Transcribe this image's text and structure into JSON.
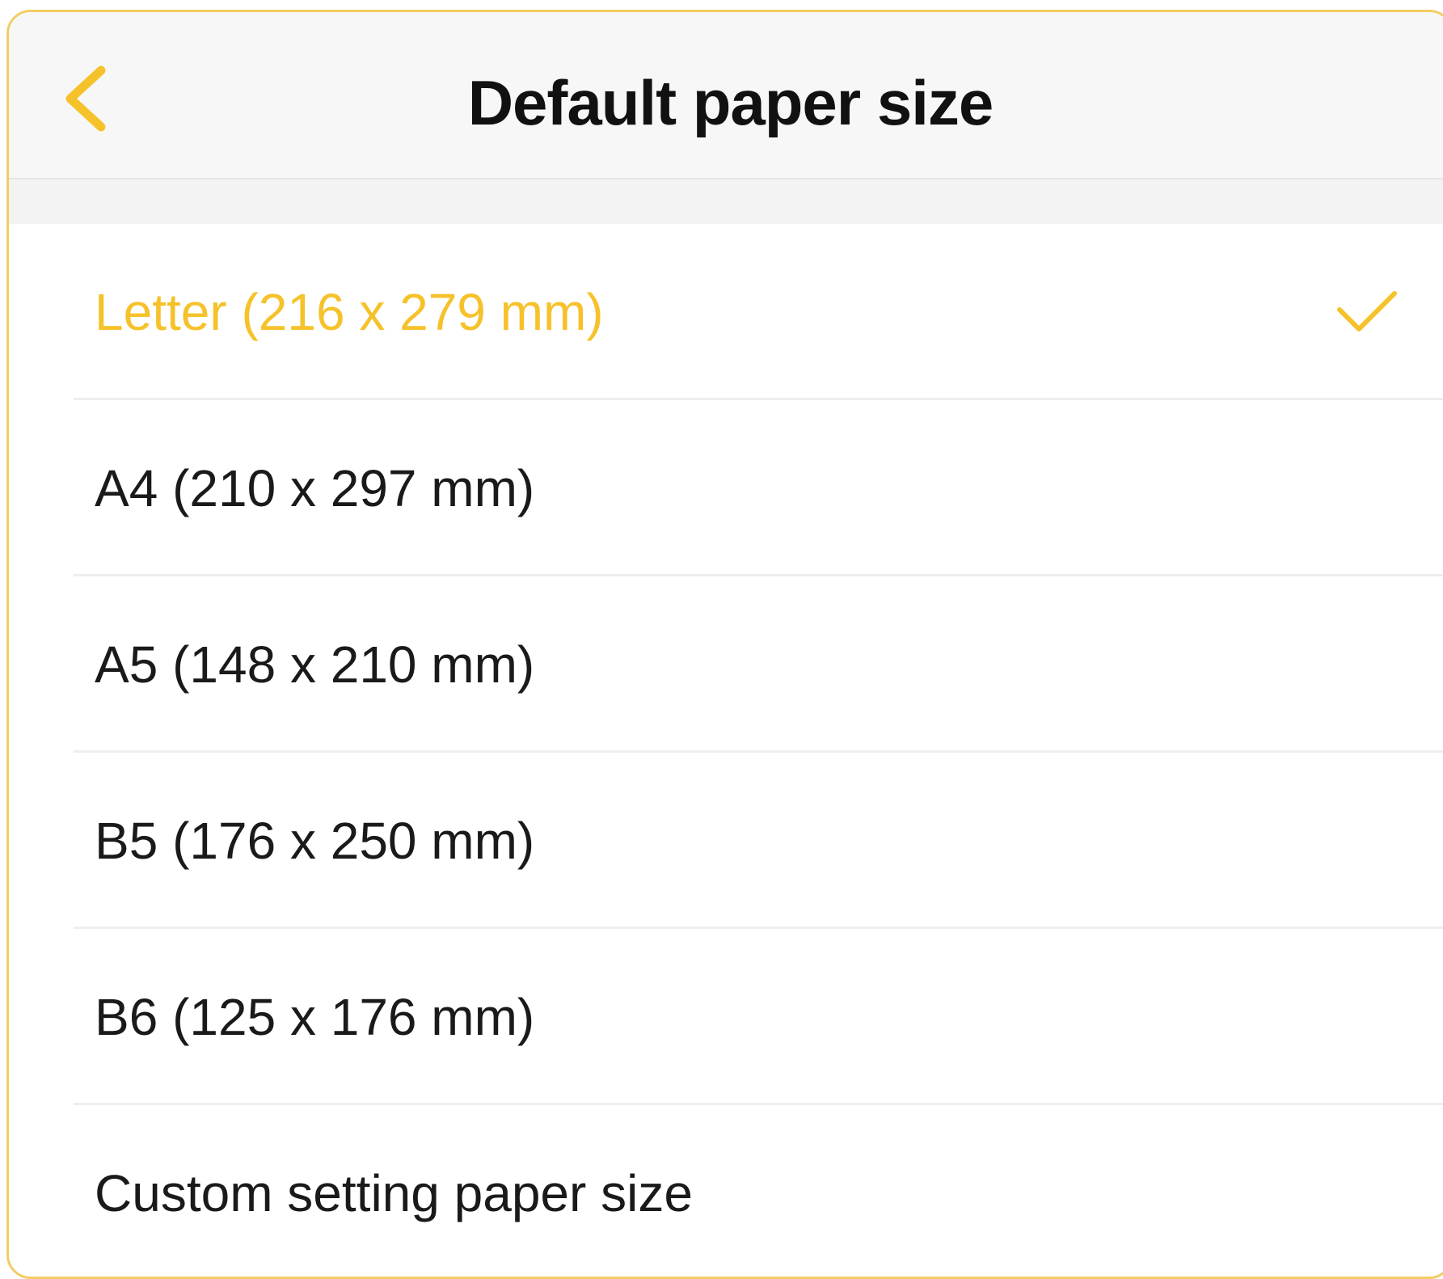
{
  "header": {
    "title": "Default paper size",
    "back_icon": "chevron-left-icon"
  },
  "colors": {
    "accent": "#f6c22b",
    "text": "#1a1a1a",
    "header_bg": "#f7f7f7"
  },
  "paper_sizes": {
    "items": [
      {
        "label": "Letter (216 x 279 mm)",
        "selected": true
      },
      {
        "label": "A4 (210 x 297 mm)",
        "selected": false
      },
      {
        "label": "A5 (148 x 210 mm)",
        "selected": false
      },
      {
        "label": "B5 (176 x 250 mm)",
        "selected": false
      },
      {
        "label": "B6 (125 x 176 mm)",
        "selected": false
      },
      {
        "label": "Custom setting paper size",
        "selected": false
      }
    ],
    "selected_icon": "check-icon"
  }
}
